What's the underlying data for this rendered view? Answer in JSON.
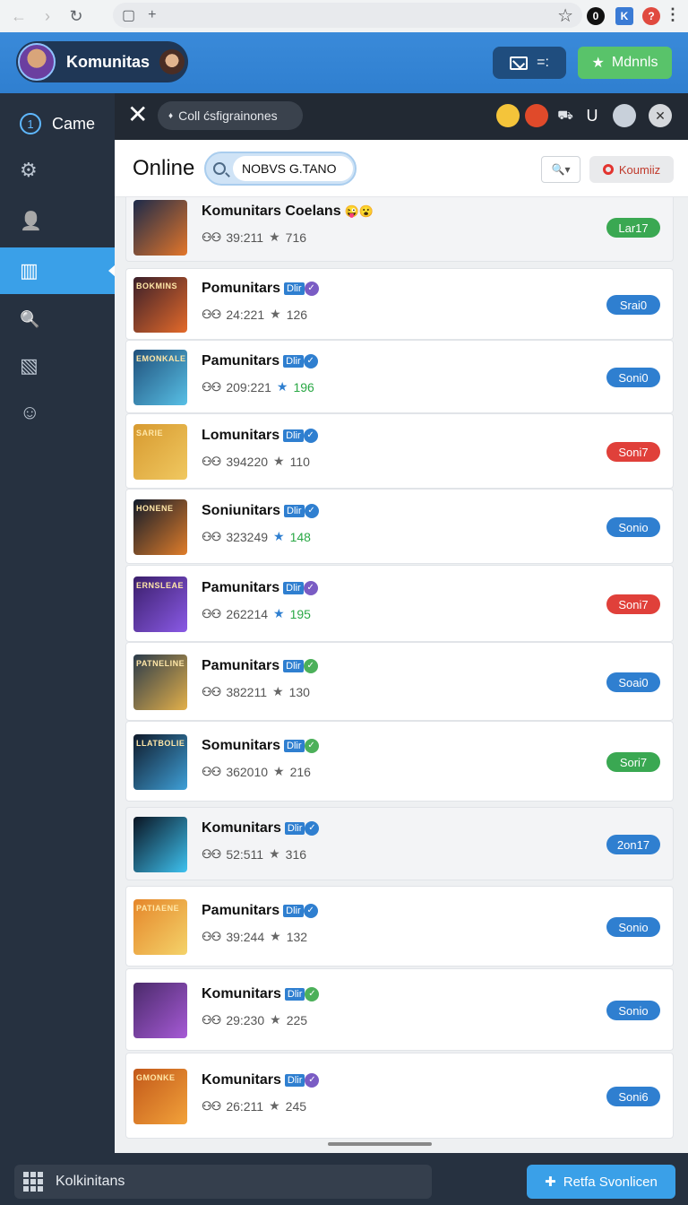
{
  "browser": {
    "back": "←",
    "forward": "›",
    "reload": "↻",
    "tab_icon": "▢",
    "new_tab": "+",
    "bookmark": "☆",
    "extensions": [
      {
        "icon": "circle-badge-icon",
        "color": "#111111",
        "glyph": "0"
      },
      {
        "icon": "k-extension-icon",
        "color": "#3a7bd5",
        "glyph": "K"
      },
      {
        "icon": "question-badge-icon",
        "color": "#e04a3f",
        "glyph": "?"
      }
    ],
    "menu": "⋮"
  },
  "header": {
    "title": "Komunitas",
    "mail_glyph": "=:",
    "action_button": "Mdnnls",
    "action_icon": "★"
  },
  "sidebar": {
    "items": [
      {
        "icon": "number-one-icon",
        "glyph": "1",
        "label": "Came"
      },
      {
        "icon": "gear-icon",
        "glyph": "⚙"
      },
      {
        "icon": "people-icon",
        "glyph": "👤"
      },
      {
        "icon": "clipboard-icon",
        "glyph": "▥",
        "active": true
      },
      {
        "icon": "search-icon",
        "glyph": "🔍"
      },
      {
        "icon": "document-icon",
        "glyph": "▧"
      },
      {
        "icon": "refresh-face-icon",
        "glyph": "☺"
      }
    ]
  },
  "toolbar": {
    "close": "✕",
    "chip_icon": "♦",
    "chip_label": "Coll ćsfigrainones",
    "icons": [
      {
        "icon": "emoji-icon",
        "glyph": "😮",
        "bg": "#f4c43a"
      },
      {
        "icon": "avatar-red-icon",
        "glyph": "●",
        "bg": "#e04a2a"
      },
      {
        "icon": "vehicle-icon",
        "glyph": "⛟",
        "bg": "#222933"
      },
      {
        "icon": "u-letter-icon",
        "glyph": "U",
        "bg": "#222933"
      },
      {
        "icon": "avatar-portrait-icon",
        "glyph": "☻",
        "bg": "#c8d0da"
      },
      {
        "icon": "close-circle-icon",
        "glyph": "✕",
        "bg": "#d5d8dc"
      }
    ]
  },
  "filter_bar": {
    "heading": "Online",
    "search_value": "NOBVS G.TANO",
    "filter_label": "🔍▾",
    "status_button": "Koumiiz"
  },
  "list": [
    {
      "name": "Komunitars Coelans",
      "suffix": "😜😮",
      "tag": "",
      "members": "39:211",
      "rating": "716",
      "rating_color": "grey",
      "status": "Lar17",
      "status_color": "#3aa852",
      "thumb": [
        "#1c2a4a",
        "#e3762a"
      ],
      "thumb_text": ""
    },
    {
      "name": "Pomunitars",
      "suffix": "",
      "tag": "Dlir",
      "members": "24:221",
      "rating": "126",
      "rating_color": "grey",
      "status": "Srai0",
      "status_color": "#2f7fd0",
      "thumb": [
        "#3a1f2a",
        "#e46a2a"
      ],
      "thumb_text": "BOKMINS",
      "verify_color": "#7a5cc4"
    },
    {
      "name": "Pamunitars",
      "suffix": "",
      "tag": "Dlir",
      "members": "209:221",
      "rating": "196",
      "rating_color": "green",
      "status": "Soni0",
      "status_color": "#2f7fd0",
      "thumb": [
        "#1f4f7a",
        "#58c0e6"
      ],
      "thumb_text": "EMONKALE",
      "verify_color": "#2f7fd0"
    },
    {
      "name": "Lomunitars",
      "suffix": "",
      "tag": "Dlir",
      "members": "394220",
      "rating": "110",
      "rating_color": "grey",
      "status": "Soni7",
      "status_color": "#e0403a",
      "thumb": [
        "#d79a30",
        "#f0c860"
      ],
      "thumb_text": "SARIE",
      "verify_color": "#2f7fd0"
    },
    {
      "name": "Soniunitars",
      "suffix": "",
      "tag": "Dlir",
      "members": "323249",
      "rating": "148",
      "rating_color": "green",
      "status": "Sonio",
      "status_color": "#2f7fd0",
      "thumb": [
        "#101a2a",
        "#e07d2a"
      ],
      "thumb_text": "HONENE",
      "verify_color": "#2f7fd0"
    },
    {
      "name": "Pamunitars",
      "suffix": "",
      "tag": "Dlir",
      "members": "262214",
      "rating": "195",
      "rating_color": "green",
      "status": "Soni7",
      "status_color": "#e0403a",
      "thumb": [
        "#3a1e6a",
        "#8a5ae6"
      ],
      "thumb_text": "ERNSLEAE",
      "verify_color": "#7a5cc4"
    },
    {
      "name": "Pamunitars",
      "suffix": "",
      "tag": "Dlir",
      "members": "382211",
      "rating": "130",
      "rating_color": "grey",
      "status": "Soai0",
      "status_color": "#2f7fd0",
      "thumb": [
        "#2a3a4a",
        "#e3b04a"
      ],
      "thumb_text": "PATNELINE",
      "verify_color": "#4cb05a"
    },
    {
      "name": "Somunitars",
      "suffix": "",
      "tag": "Dlir",
      "members": "362010",
      "rating": "216",
      "rating_color": "grey",
      "status": "Sori7",
      "status_color": "#3aa852",
      "thumb": [
        "#0f1a2a",
        "#3fa0d8"
      ],
      "thumb_text": "LLATBOLIE",
      "verify_color": "#4cb05a"
    },
    {
      "name": "Komunitars",
      "suffix": "",
      "tag": "Dlir",
      "members": "52:511",
      "rating": "316",
      "rating_color": "grey",
      "status": "2on17",
      "status_color": "#2f7fd0",
      "thumb": [
        "#0a1422",
        "#3ec2f0"
      ],
      "thumb_text": "",
      "verify_color": "#2f7fd0",
      "alt": true
    },
    {
      "name": "Pamunitars",
      "suffix": "",
      "tag": "Dlir",
      "members": "39:244",
      "rating": "132",
      "rating_color": "grey",
      "status": "Sonio",
      "status_color": "#2f7fd0",
      "thumb": [
        "#e5862a",
        "#f4d36a"
      ],
      "thumb_text": "PATIAENE",
      "verify_color": "#2f7fd0"
    },
    {
      "name": "Komunitars",
      "suffix": "",
      "tag": "Dlir",
      "members": "29:230",
      "rating": "225",
      "rating_color": "grey",
      "status": "Sonio",
      "status_color": "#2f7fd0",
      "thumb": [
        "#4a2a6a",
        "#a65ad6"
      ],
      "thumb_text": "",
      "verify_color": "#4cb05a"
    },
    {
      "name": "Komunitars",
      "suffix": "",
      "tag": "Dlir",
      "members": "26:211",
      "rating": "245",
      "rating_color": "grey",
      "status": "Soni6",
      "status_color": "#2f7fd0",
      "thumb": [
        "#c2581a",
        "#f2a23a"
      ],
      "thumb_text": "GMONKE",
      "verify_color": "#7a5cc4"
    }
  ],
  "bottom": {
    "input_value": "Kolkinitans",
    "button_label": "Retfa Svonlicen",
    "button_icon": "✚"
  }
}
